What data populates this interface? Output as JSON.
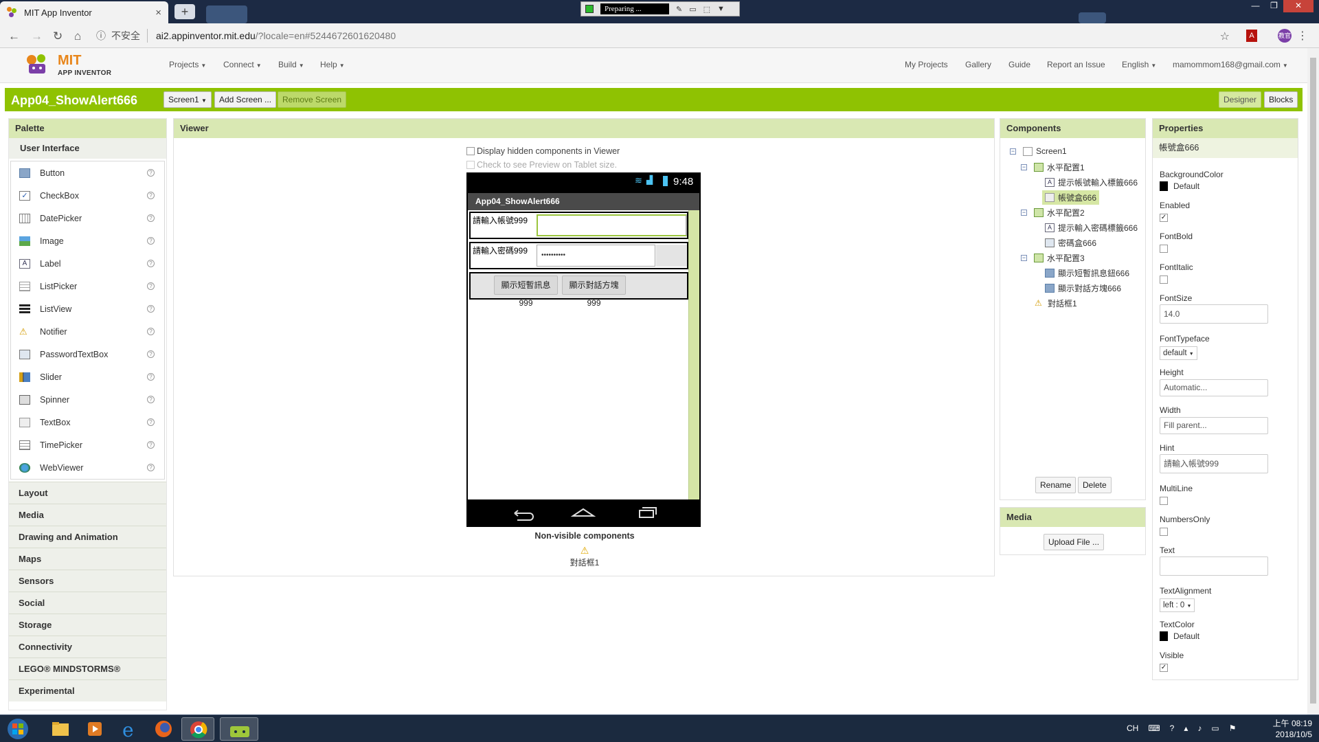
{
  "browser": {
    "tab_title": "MIT App Inventor",
    "tab_close": "×",
    "new_tab": "+",
    "downloader_status": "Preparing ...",
    "security_label": "不安全",
    "url_host": "ai2.appinventor.mit.edu",
    "url_path": "/?locale=en#5244672601620480",
    "profile_initials": "教官"
  },
  "header": {
    "logo_mit": "MIT",
    "logo_sub": "APP INVENTOR",
    "menus": [
      "Projects",
      "Connect",
      "Build",
      "Help"
    ],
    "links": [
      "My Projects",
      "Gallery",
      "Guide",
      "Report an Issue",
      "English",
      "mamommom168@gmail.com"
    ]
  },
  "toolbar": {
    "project_name": "App04_ShowAlert666",
    "screen_select": "Screen1",
    "add_screen": "Add Screen ...",
    "remove_screen": "Remove Screen",
    "designer": "Designer",
    "blocks": "Blocks"
  },
  "palette": {
    "title": "Palette",
    "open_category": "User Interface",
    "items": [
      {
        "label": "Button",
        "icon": "button-icon"
      },
      {
        "label": "CheckBox",
        "icon": "checkbox-icon"
      },
      {
        "label": "DatePicker",
        "icon": "datepicker-icon"
      },
      {
        "label": "Image",
        "icon": "image-icon"
      },
      {
        "label": "Label",
        "icon": "label-icon"
      },
      {
        "label": "ListPicker",
        "icon": "listpicker-icon"
      },
      {
        "label": "ListView",
        "icon": "listview-icon"
      },
      {
        "label": "Notifier",
        "icon": "notifier-icon"
      },
      {
        "label": "PasswordTextBox",
        "icon": "password-icon"
      },
      {
        "label": "Slider",
        "icon": "slider-icon"
      },
      {
        "label": "Spinner",
        "icon": "spinner-icon"
      },
      {
        "label": "TextBox",
        "icon": "textbox-icon"
      },
      {
        "label": "TimePicker",
        "icon": "timepicker-icon"
      },
      {
        "label": "WebViewer",
        "icon": "webviewer-icon"
      }
    ],
    "help_mark": "?",
    "categories": [
      "Layout",
      "Media",
      "Drawing and Animation",
      "Maps",
      "Sensors",
      "Social",
      "Storage",
      "Connectivity",
      "LEGO® MINDSTORMS®",
      "Experimental"
    ]
  },
  "viewer": {
    "title": "Viewer",
    "hidden_option": "Display hidden components in Viewer",
    "tablet_option": "Check to see Preview on Tablet size.",
    "phone_time": "9:48",
    "app_title": "App04_ShowAlert666",
    "row1_label": "請輸入帳號999",
    "row2_label": "請輸入密碼999",
    "password_mask": "••••••••••",
    "button1": "顯示短暫訊息999",
    "button2": "顯示對話方塊999",
    "nonvisible_title": "Non-visible components",
    "nonvisible_item": "對話框1"
  },
  "components": {
    "title": "Components",
    "tree": [
      {
        "label": "Screen1",
        "level": 0,
        "toggle": "⊟"
      },
      {
        "label": "水平配置1",
        "level": 1,
        "toggle": "⊟"
      },
      {
        "label": "提示帳號輸入標籤666",
        "level": 2
      },
      {
        "label": "帳號盒666",
        "level": 2,
        "selected": true
      },
      {
        "label": "水平配置2",
        "level": 1,
        "toggle": "⊟"
      },
      {
        "label": "提示輸入密碼標籤666",
        "level": 2
      },
      {
        "label": "密碼盒666",
        "level": 2
      },
      {
        "label": "水平配置3",
        "level": 1,
        "toggle": "⊟"
      },
      {
        "label": "顯示短暫訊息鈕666",
        "level": 2
      },
      {
        "label": "顯示對話方塊666",
        "level": 2
      },
      {
        "label": "對話框1",
        "level": 1
      }
    ],
    "rename": "Rename",
    "delete": "Delete"
  },
  "media": {
    "title": "Media",
    "upload": "Upload File ..."
  },
  "properties": {
    "title": "Properties",
    "selected_component": "帳號盒666",
    "background_color_label": "BackgroundColor",
    "background_color_value": "Default",
    "enabled_label": "Enabled",
    "enabled": true,
    "fontbold_label": "FontBold",
    "fontbold": false,
    "fontitalic_label": "FontItalic",
    "fontitalic": false,
    "fontsize_label": "FontSize",
    "fontsize_value": "14.0",
    "fonttypeface_label": "FontTypeface",
    "fonttypeface_value": "default",
    "height_label": "Height",
    "height_value": "Automatic...",
    "width_label": "Width",
    "width_value": "Fill parent...",
    "hint_label": "Hint",
    "hint_value": "請輸入帳號999",
    "multiline_label": "MultiLine",
    "multiline": false,
    "numbersonly_label": "NumbersOnly",
    "numbersonly": false,
    "text_label": "Text",
    "text_value": "",
    "textalignment_label": "TextAlignment",
    "textalignment_value": "left : 0",
    "textcolor_label": "TextColor",
    "textcolor_value": "Default",
    "visible_label": "Visible",
    "visible": true
  },
  "taskbar": {
    "lang": "CH",
    "time": "上午 08:19",
    "date": "2018/10/5"
  },
  "colors": {
    "accent_green": "#8fc202",
    "panel_header": "#d9e8b3"
  }
}
